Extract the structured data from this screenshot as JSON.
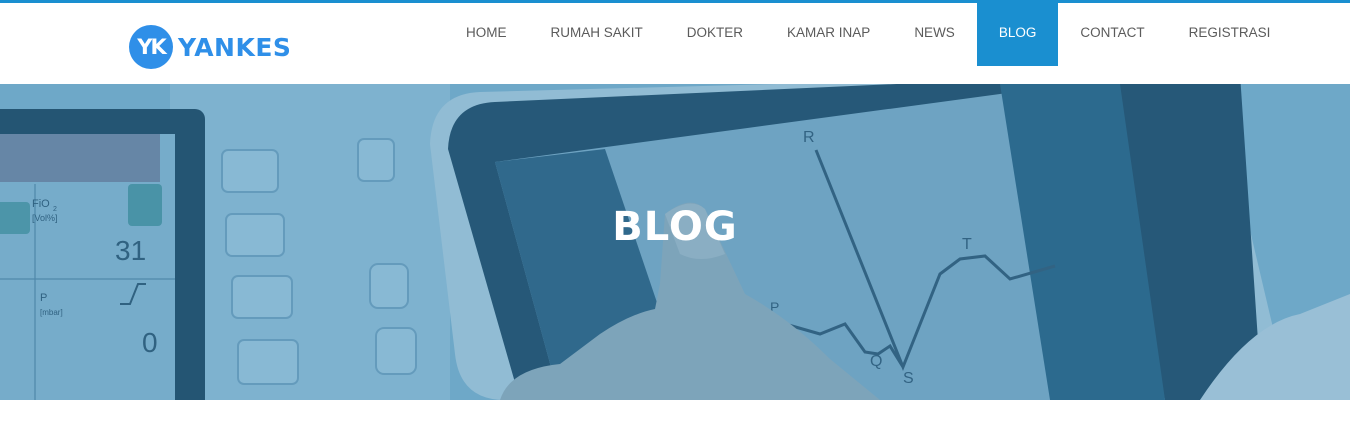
{
  "logo": {
    "badge": "YK",
    "text": "YANKES"
  },
  "nav": {
    "items": [
      {
        "label": "HOME",
        "name": "nav-home"
      },
      {
        "label": "RUMAH SAKIT",
        "name": "nav-rumah-sakit"
      },
      {
        "label": "DOKTER",
        "name": "nav-dokter"
      },
      {
        "label": "KAMAR INAP",
        "name": "nav-kamar-inap"
      },
      {
        "label": "NEWS",
        "name": "nav-news"
      },
      {
        "label": "BLOG",
        "name": "nav-blog",
        "active": true
      },
      {
        "label": "CONTACT",
        "name": "nav-contact"
      },
      {
        "label": "REGISTRASI",
        "name": "nav-registrasi"
      }
    ]
  },
  "hero": {
    "title": "BLOG",
    "monitor": {
      "fio2": "FiO",
      "fio2_sub": "2",
      "unit": "[Vol%]",
      "value1": "31",
      "p_label": "P",
      "p_unit": "[mbar]",
      "value2": "0"
    },
    "ecg": {
      "r": "R",
      "t": "T",
      "q": "Q",
      "s": "S",
      "p": "P"
    }
  },
  "colors": {
    "accent": "#1a8fd0",
    "logo": "#2f8fe8",
    "hero_overlay": "#3b86b3"
  }
}
